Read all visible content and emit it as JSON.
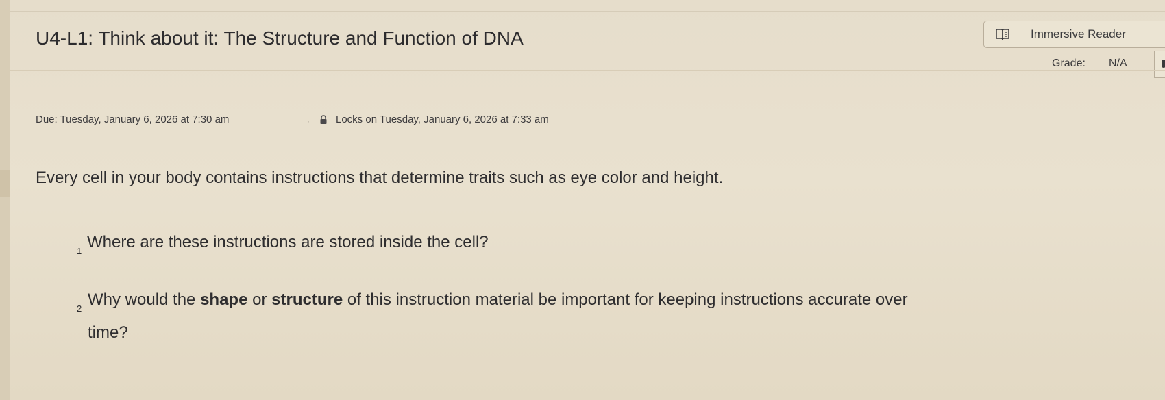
{
  "assignment": {
    "title": "U4-L1: Think about it: The Structure and Function of DNA",
    "immersive_reader_label": "Immersive Reader",
    "grade_label": "Grade:",
    "grade_value": "N/A",
    "due": "Due: Tuesday, January 6, 2026 at 7:30 am",
    "separator": "·",
    "locks": "Locks on Tuesday, January 6, 2026 at 7:33 am"
  },
  "content": {
    "intro": "Every cell in your body contains instructions that determine traits such as eye color and height.",
    "questions": [
      {
        "number": "1",
        "text": "Where are these instructions are stored inside the cell?"
      },
      {
        "number": "2",
        "text_before": "Why would the ",
        "bold_1": "shape",
        "text_middle": " or ",
        "bold_2": "structure",
        "text_after": " of this instruction material be important for keeping instructions accurate over",
        "text_wrap": "time?"
      }
    ]
  },
  "icons": {
    "immersive_reader": "immersive-reader-icon",
    "lock": "lock-icon"
  },
  "colors": {
    "background": "#e8dfcc",
    "text": "#2d2c2e",
    "border": "#b9ae9b"
  }
}
